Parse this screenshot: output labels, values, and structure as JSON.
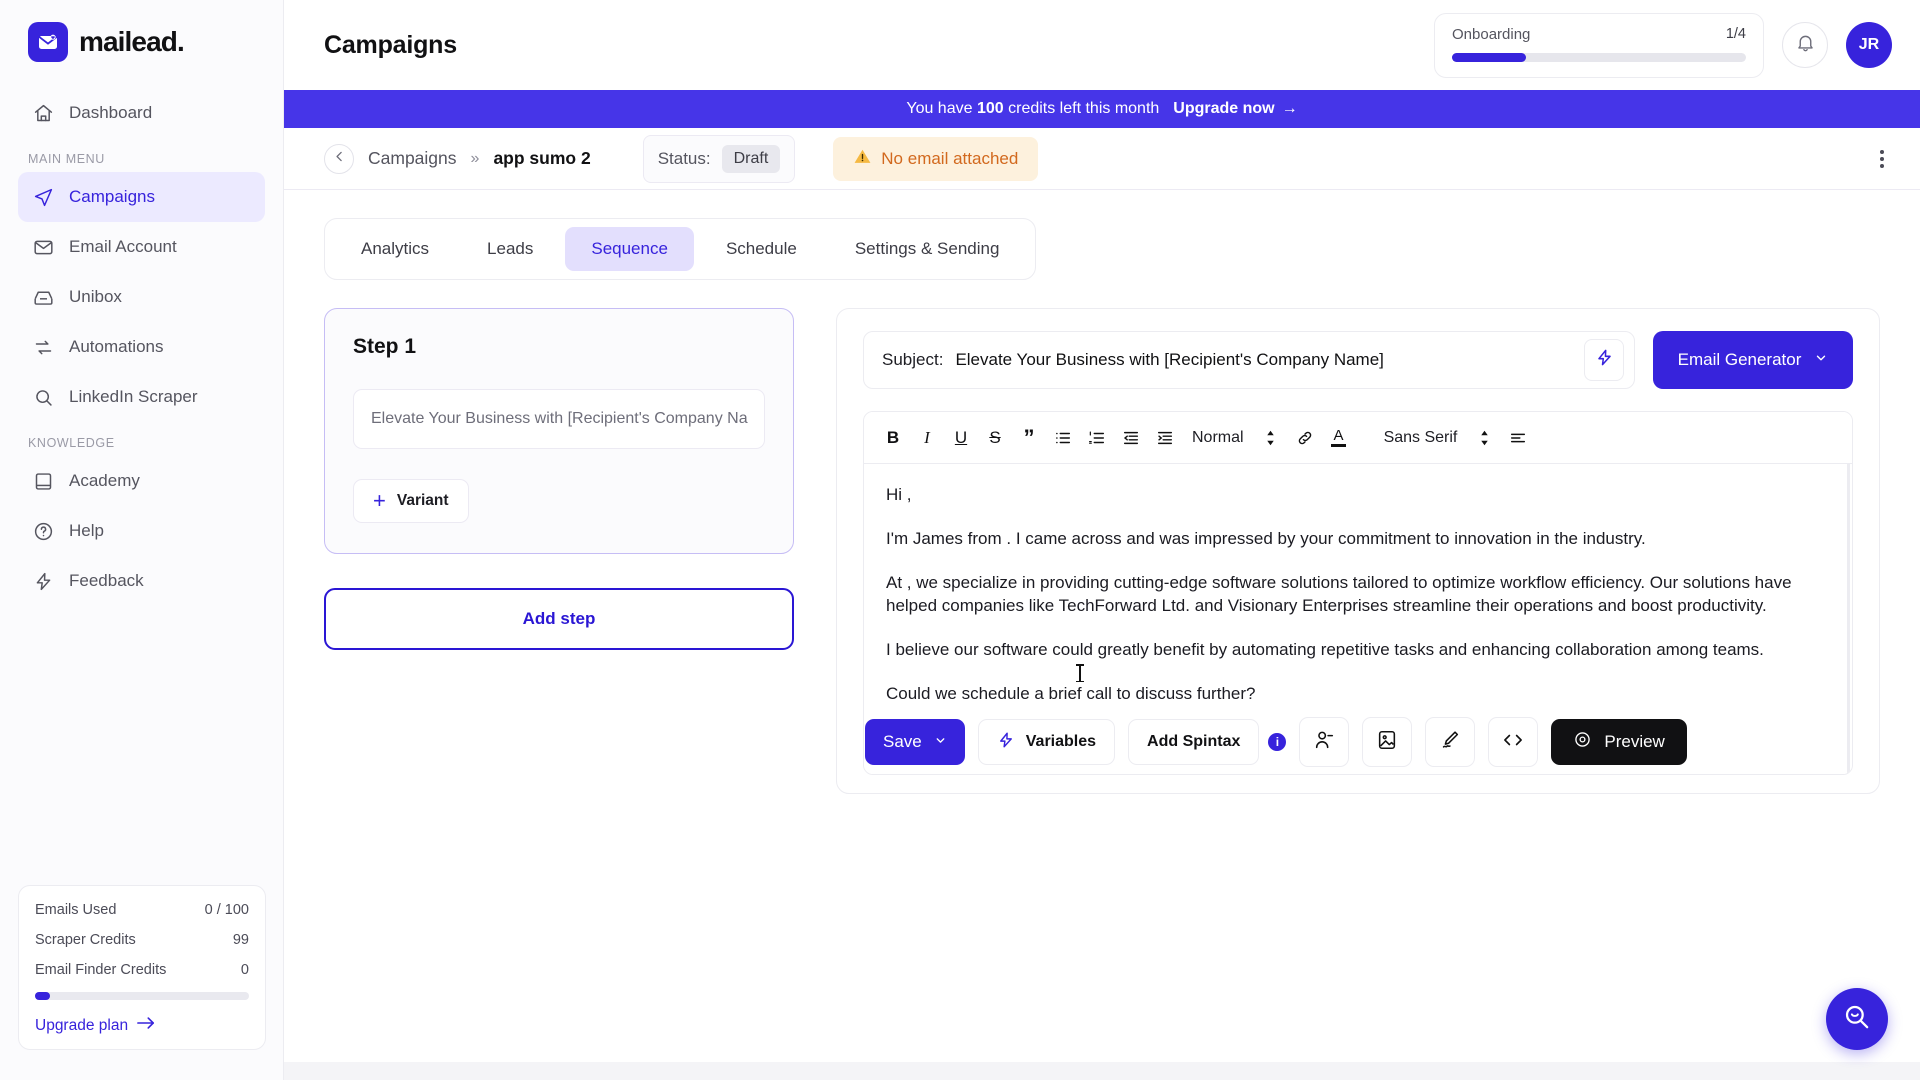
{
  "brand": {
    "name": "mailead.",
    "icon": "mail-heart-icon",
    "accent": "#3723dc"
  },
  "sidebar": {
    "primary": [
      {
        "label": "Dashboard",
        "icon": "home-icon",
        "active": false
      }
    ],
    "main_menu_label": "MAIN MENU",
    "main_menu": [
      {
        "label": "Campaigns",
        "icon": "paper-plane-icon",
        "active": true
      },
      {
        "label": "Email Account",
        "icon": "envelope-icon",
        "active": false
      },
      {
        "label": "Unibox",
        "icon": "inbox-icon",
        "active": false
      },
      {
        "label": "Automations",
        "icon": "refresh-icon",
        "active": false
      },
      {
        "label": "LinkedIn Scraper",
        "icon": "search-icon",
        "active": false
      }
    ],
    "knowledge_label": "KNOWLEDGE",
    "knowledge": [
      {
        "label": "Academy",
        "icon": "book-icon",
        "active": false
      },
      {
        "label": "Help",
        "icon": "question-circle-icon",
        "active": false
      },
      {
        "label": "Feedback",
        "icon": "bolt-icon",
        "active": false
      }
    ],
    "usage": {
      "rows": [
        {
          "label": "Emails Used",
          "value": "0 / 100"
        },
        {
          "label": "Scraper Credits",
          "value": "99"
        },
        {
          "label": "Email Finder Credits",
          "value": "0"
        }
      ],
      "progress_percent": 7,
      "upgrade_label": "Upgrade plan"
    }
  },
  "header": {
    "title": "Campaigns",
    "onboarding": {
      "label": "Onboarding",
      "count": "1/4",
      "progress_percent": 25
    },
    "bell_icon": "bell-icon",
    "avatar_initials": "JR"
  },
  "banner": {
    "prefix": "You have",
    "credits": "100",
    "suffix": "credits left this month",
    "upgrade_label": "Upgrade now",
    "arrow": "→"
  },
  "breadcrumb": {
    "back_icon": "chevron-left-icon",
    "parent": "Campaigns",
    "separator": "»",
    "current": "app sumo 2",
    "status_label": "Status:",
    "status_value": "Draft",
    "warning_icon": "warning-triangle-icon",
    "warning_text": "No email attached"
  },
  "tabs": [
    {
      "label": "Analytics",
      "active": false
    },
    {
      "label": "Leads",
      "active": false
    },
    {
      "label": "Sequence",
      "active": true
    },
    {
      "label": "Schedule",
      "active": false
    },
    {
      "label": "Settings & Sending",
      "active": false
    }
  ],
  "sequence": {
    "step_title": "Step 1",
    "step_subject": "Elevate Your Business with [Recipient's Company Na",
    "variant_label": "Variant",
    "add_step_label": "Add step"
  },
  "editor": {
    "subject_label": "Subject:",
    "subject_value": "Elevate Your Business with [Recipient's Company Name]",
    "bolt_icon": "bolt-icon",
    "generator_label": "Email Generator",
    "generator_caret": "chevron-down-icon",
    "toolbar": {
      "bold": "B",
      "italic": "I",
      "underline": "U",
      "strike": "S",
      "quote": "”",
      "bullet_list": "bullet-list-icon",
      "numbered_list": "numbered-list-icon",
      "outdent": "outdent-icon",
      "indent": "indent-icon",
      "block_format": "Normal",
      "link": "link-icon",
      "text_color": "A",
      "font_family": "Sans Serif",
      "align": "align-icon"
    },
    "body_paragraphs": [
      "Hi ,",
      "I'm James from . I came across and was impressed by your commitment to innovation in the industry.",
      "At , we specialize in providing cutting-edge software solutions tailored to optimize workflow efficiency. Our solutions have helped companies like TechForward Ltd. and Visionary Enterprises streamline their operations and boost productivity.",
      "I believe our software could greatly benefit by automating repetitive tasks and enhancing collaboration among teams.",
      "Could we schedule a brief call to discuss further?"
    ],
    "actions": {
      "save_label": "Save",
      "save_caret": "chevron-down-icon",
      "variables_label": "Variables",
      "variables_icon": "bolt-icon",
      "spintax_label": "Add Spintax",
      "spintax_info": "i",
      "unsubscribe_icon": "person-minus-icon",
      "image_icon": "image-icon",
      "signature_icon": "signature-pen-icon",
      "code_icon": "code-icon",
      "preview_label": "Preview",
      "preview_icon": "eye-icon"
    }
  },
  "fab": {
    "icon": "search-smile-icon"
  }
}
